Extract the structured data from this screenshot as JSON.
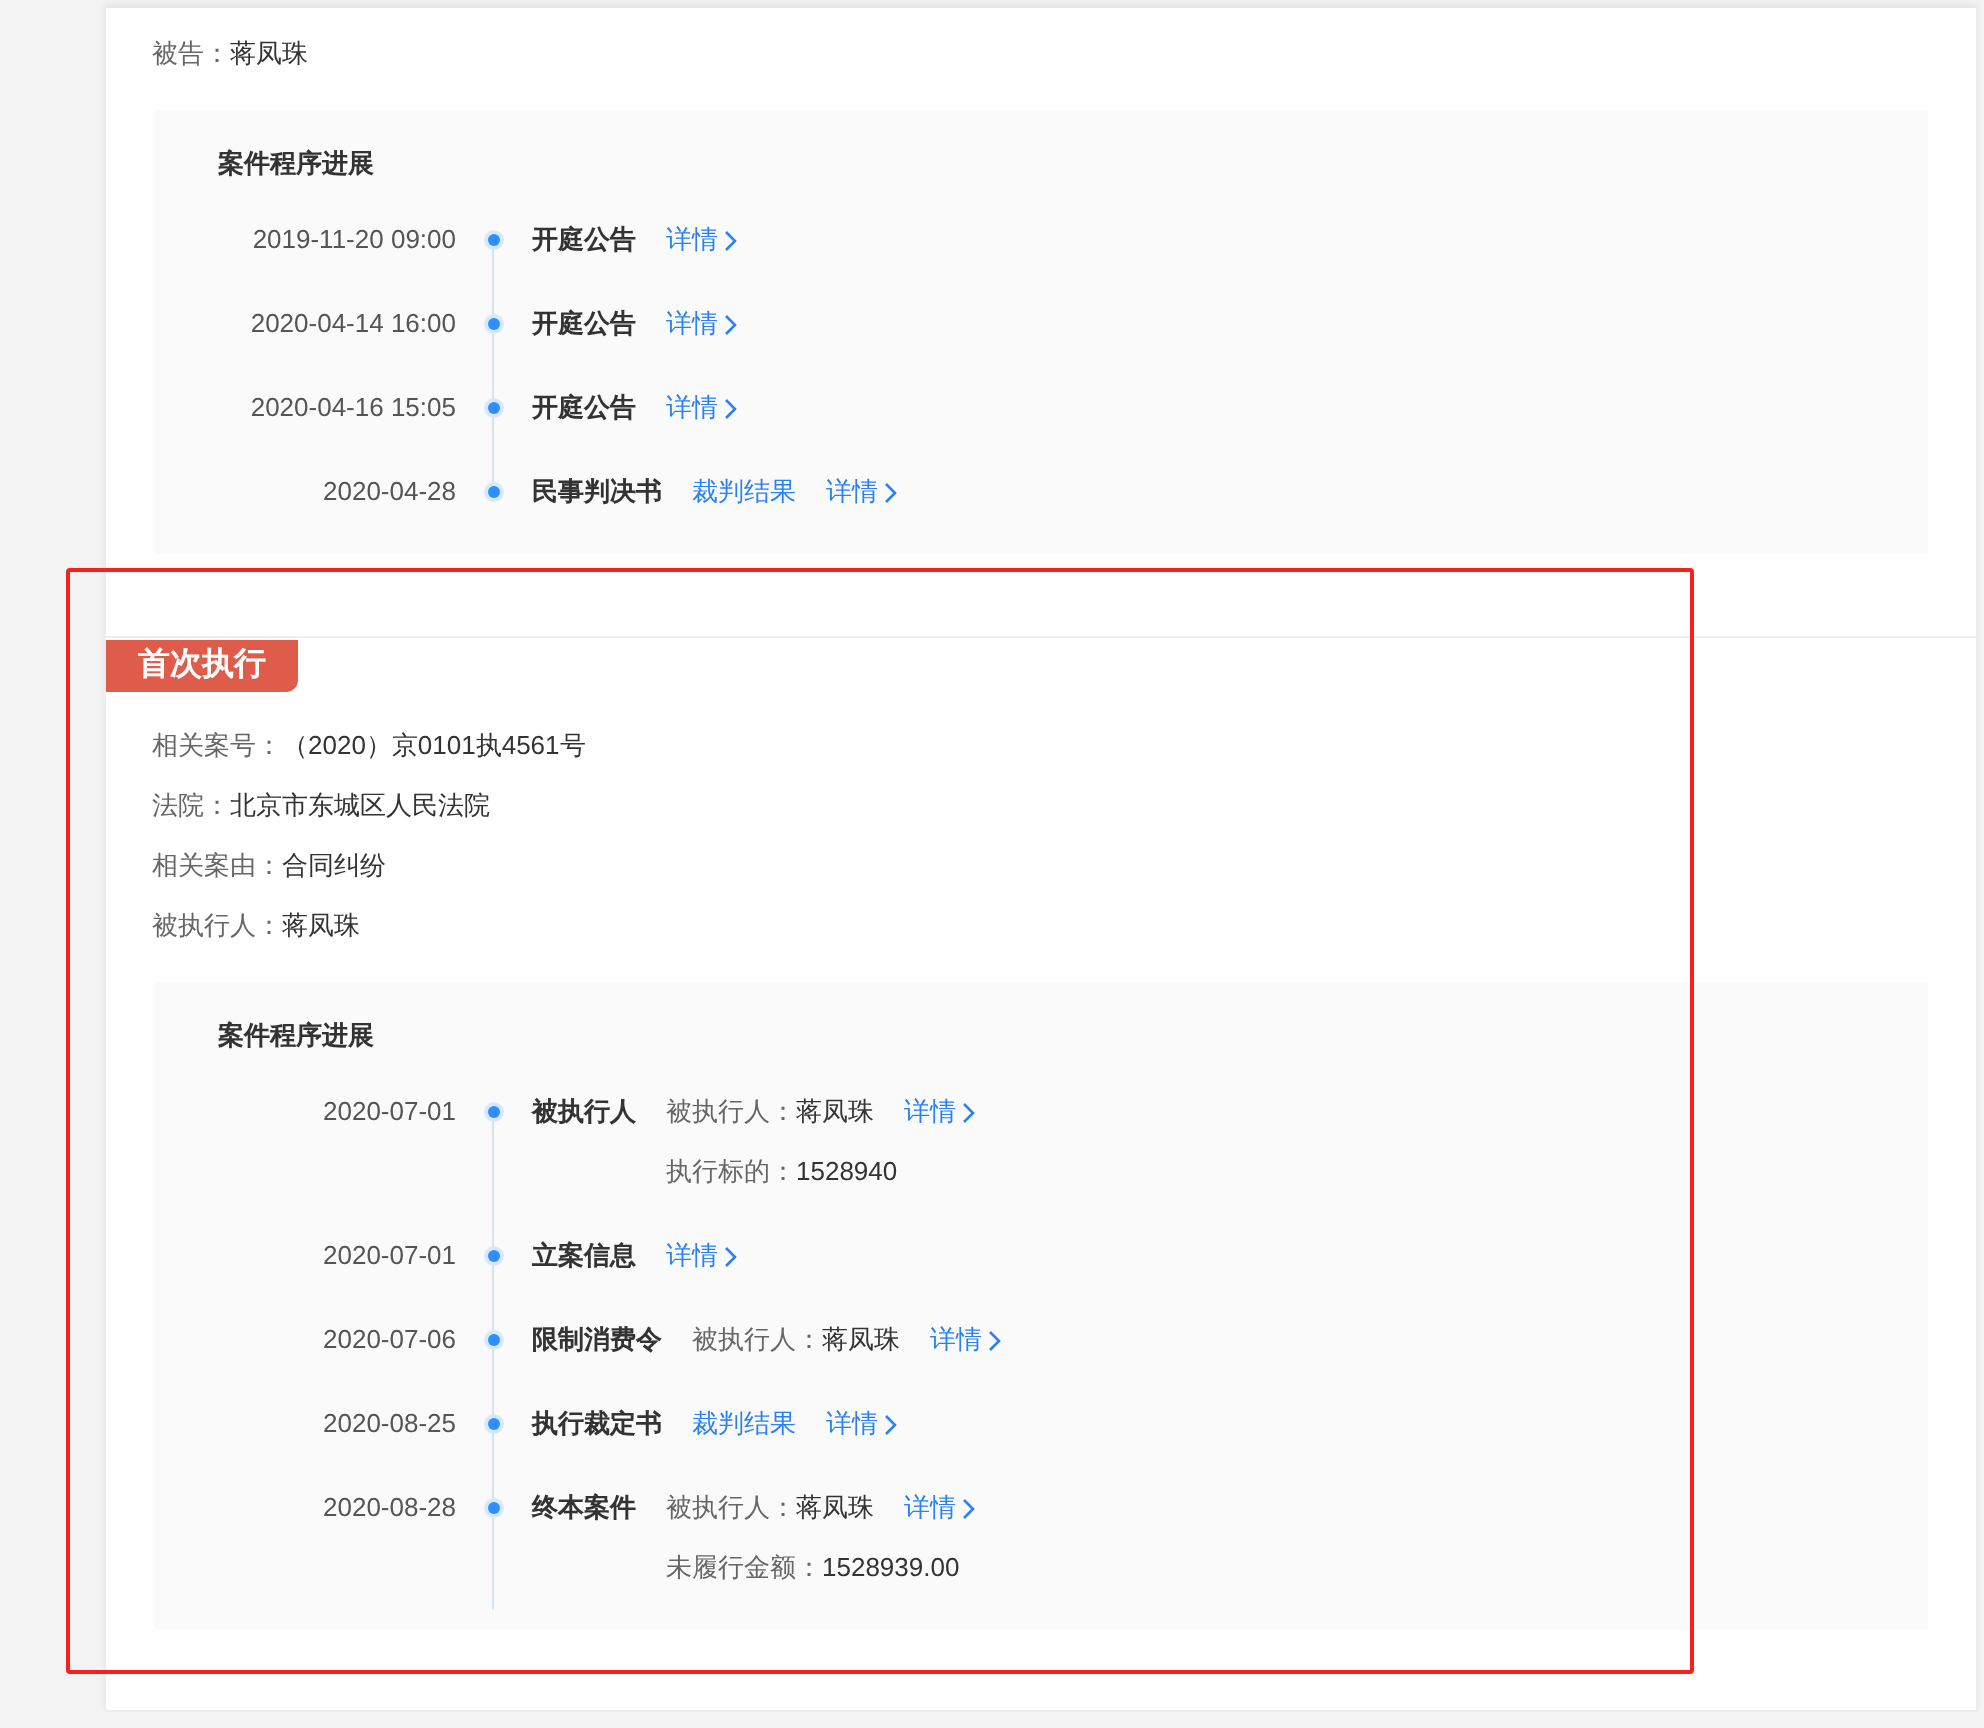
{
  "sections": [
    {
      "fields": [
        {
          "label": "被告：",
          "value": "蒋凤珠"
        }
      ],
      "progress": {
        "title": "案件程序进展",
        "events": [
          {
            "date": "2019-11-20 09:00",
            "title": "开庭公告",
            "detail_link": "详情"
          },
          {
            "date": "2020-04-14 16:00",
            "title": "开庭公告",
            "detail_link": "详情"
          },
          {
            "date": "2020-04-16 15:05",
            "title": "开庭公告",
            "detail_link": "详情"
          },
          {
            "date": "2020-04-28",
            "title": "民事判决书",
            "result_link": "裁判结果",
            "detail_link": "详情"
          }
        ]
      }
    },
    {
      "tag": "首次执行",
      "highlighted": true,
      "fields": [
        {
          "label": "相关案号：",
          "value": "（2020）京0101执4561号"
        },
        {
          "label": "法院：",
          "value": "北京市东城区人民法院"
        },
        {
          "label": "相关案由：",
          "value": "合同纠纷"
        },
        {
          "label": "被执行人：",
          "value": "蒋凤珠"
        }
      ],
      "progress": {
        "title": "案件程序进展",
        "events": [
          {
            "date": "2020-07-01",
            "title": "被执行人",
            "fields": [
              {
                "label": "被执行人：",
                "value": "蒋凤珠"
              },
              {
                "label": "执行标的：",
                "value": "1528940"
              }
            ],
            "detail_link": "详情"
          },
          {
            "date": "2020-07-01",
            "title": "立案信息",
            "detail_link": "详情"
          },
          {
            "date": "2020-07-06",
            "title": "限制消费令",
            "fields": [
              {
                "label": "被执行人：",
                "value": "蒋凤珠"
              }
            ],
            "detail_link": "详情"
          },
          {
            "date": "2020-08-25",
            "title": "执行裁定书",
            "result_link": "裁判结果",
            "detail_link": "详情"
          },
          {
            "date": "2020-08-28",
            "title": "终本案件",
            "fields": [
              {
                "label": "被执行人：",
                "value": "蒋凤珠"
              },
              {
                "label": "未履行金额：",
                "value": "1528939.00"
              }
            ],
            "detail_link": "详情"
          }
        ]
      }
    }
  ]
}
